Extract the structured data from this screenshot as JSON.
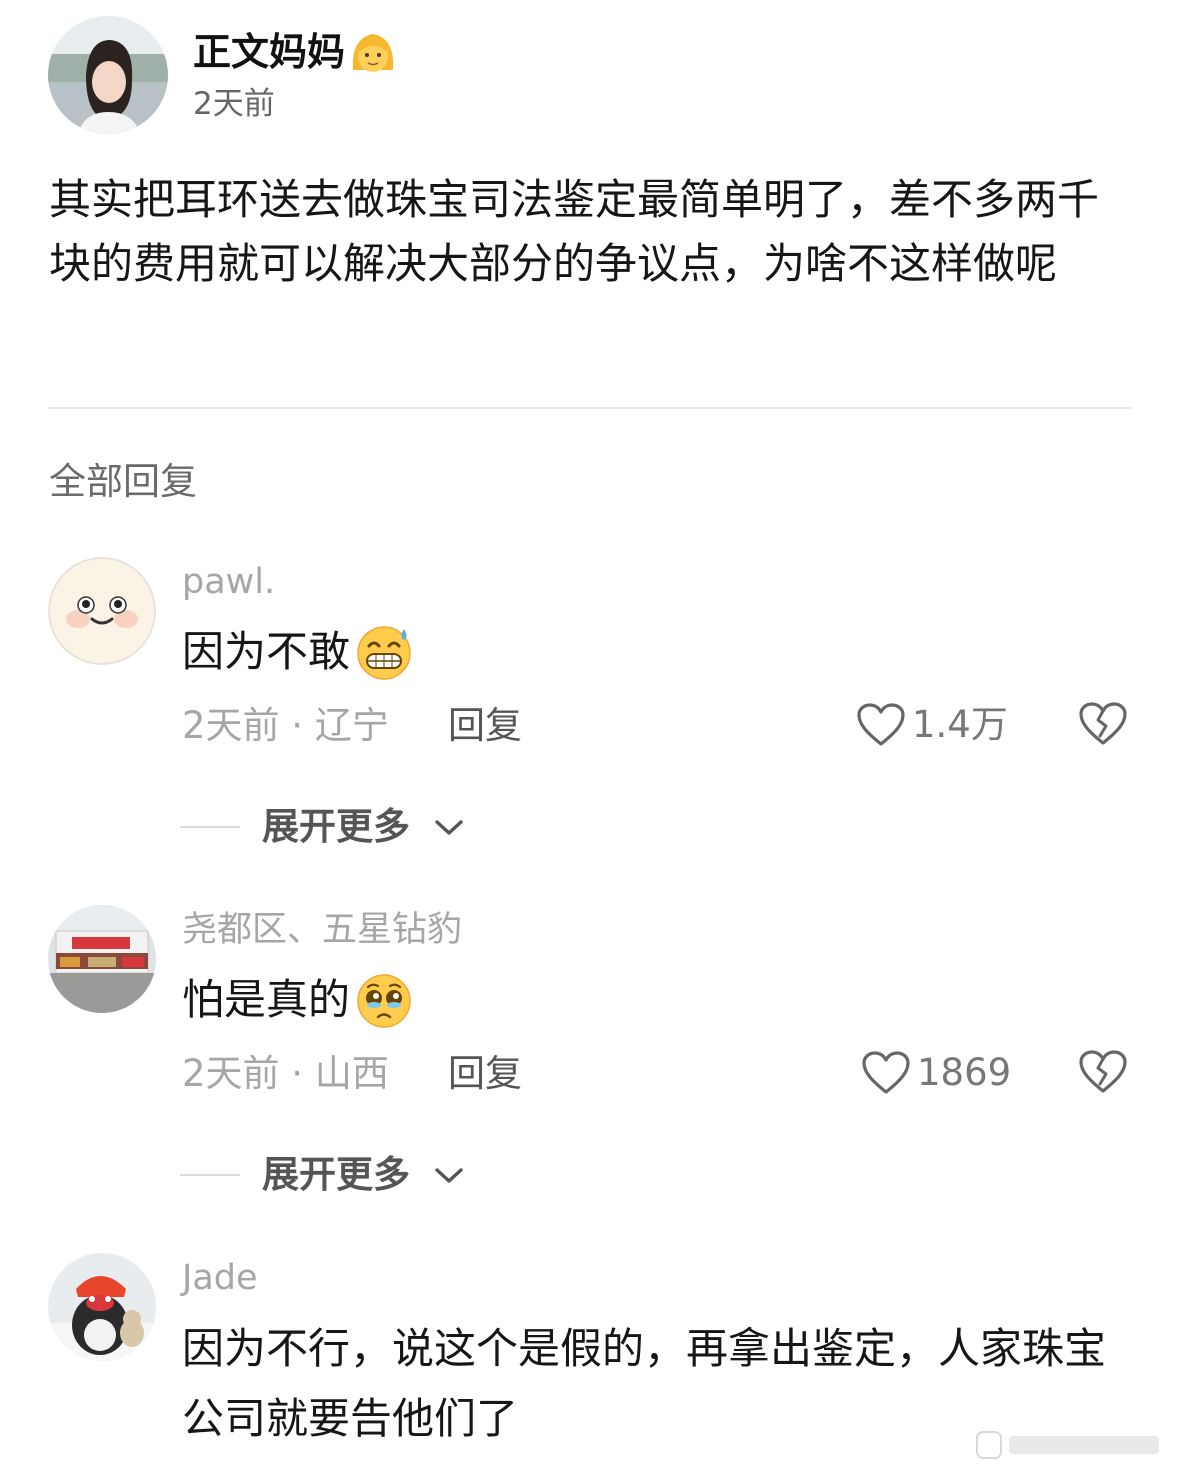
{
  "post": {
    "author": "正文妈妈",
    "author_emoji": "woman-emoji",
    "time": "2天前",
    "text": "其实把耳环送去做珠宝司法鉴定最简单明了，差不多两千块的费用就可以解决大部分的争议点，为啥不这样做呢"
  },
  "replies_title": "全部回复",
  "comments": [
    {
      "user": "pawl.",
      "text": "因为不敢",
      "emoji": "grinning-sweat-emoji",
      "meta": "2天前 · 辽宁",
      "reply": "回复",
      "likes": "1.4万",
      "expand": "展开更多"
    },
    {
      "user": "尧都区、五星钻豹",
      "text": "怕是真的",
      "emoji": "pleading-face-emoji",
      "meta": "2天前 · 山西",
      "reply": "回复",
      "likes": "1869",
      "expand": "展开更多"
    },
    {
      "user": "Jade",
      "text": "因为不行，说这个是假的，再拿出鉴定，人家珠宝公司就要告他们了"
    }
  ],
  "colors": {
    "text": "#161616",
    "muted": "#a6a6a6",
    "divider": "#e6e6e6"
  }
}
